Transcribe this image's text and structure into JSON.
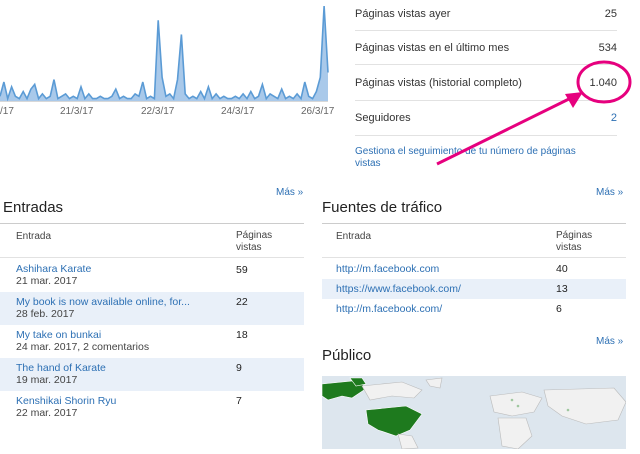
{
  "chart_data": {
    "type": "area",
    "x_tick_labels": [
      "/17",
      "21/3/17",
      "22/3/17",
      "24/3/17",
      "26/3/17"
    ],
    "series": [
      {
        "values": [
          2,
          8,
          1,
          6,
          2,
          1,
          4,
          1,
          5,
          7,
          1,
          3,
          1,
          2,
          9,
          1,
          2,
          3,
          1,
          2,
          1,
          6,
          1,
          3,
          1,
          1,
          2,
          1,
          1,
          2,
          5,
          1,
          2,
          1,
          1,
          3,
          2,
          8,
          1,
          2,
          1,
          34,
          10,
          2,
          3,
          1,
          9,
          28,
          3,
          1,
          2,
          1,
          4,
          1,
          6,
          1,
          3,
          1,
          2,
          1,
          1,
          2,
          1,
          3,
          1,
          4,
          1,
          2,
          7,
          1,
          3,
          2,
          1,
          5,
          1,
          2,
          1,
          3,
          1,
          8,
          2,
          1,
          4,
          10,
          40,
          12
        ]
      }
    ],
    "colors": {
      "line": "#5b9bd5",
      "fill": "#a9c9ea"
    }
  },
  "stats": {
    "yesterday_label": "Páginas vistas ayer",
    "yesterday_value": "25",
    "month_label": "Páginas vistas en el último mes",
    "month_value": "534",
    "all_time_label": "Páginas vistas (historial completo)",
    "all_time_value": "1.040",
    "followers_label": "Seguidores",
    "followers_value": "2",
    "manage_link_line1": "Gestiona el seguimiento de tu número de páginas",
    "manage_link_line2": "vistas"
  },
  "more_label": "Más »",
  "entries": {
    "title": "Entradas",
    "col_entry": "Entrada",
    "col_views_1": "Páginas",
    "col_views_2": "vistas",
    "rows": [
      {
        "title": "Ashihara Karate",
        "sub": "21 mar. 2017",
        "views": "59"
      },
      {
        "title": "My book is now available online, for...",
        "sub": "28 feb. 2017",
        "views": "22"
      },
      {
        "title": "My take on bunkai",
        "sub": "24 mar. 2017, 2 comentarios",
        "views": "18"
      },
      {
        "title": "The hand of Karate",
        "sub": "19 mar. 2017",
        "views": "9"
      },
      {
        "title": "Kenshikai Shorin Ryu",
        "sub": "22 mar. 2017",
        "views": "7"
      }
    ]
  },
  "traffic": {
    "title": "Fuentes de tráfico",
    "col_entry": "Entrada",
    "col_views_1": "Páginas",
    "col_views_2": "vistas",
    "rows": [
      {
        "url": "http://m.facebook.com",
        "views": "40"
      },
      {
        "url": "https://www.facebook.com/",
        "views": "13"
      },
      {
        "url": "http://m.facebook.com/",
        "views": "6"
      }
    ]
  },
  "audience": {
    "title": "Público"
  },
  "annotation_color": "#e6007e"
}
